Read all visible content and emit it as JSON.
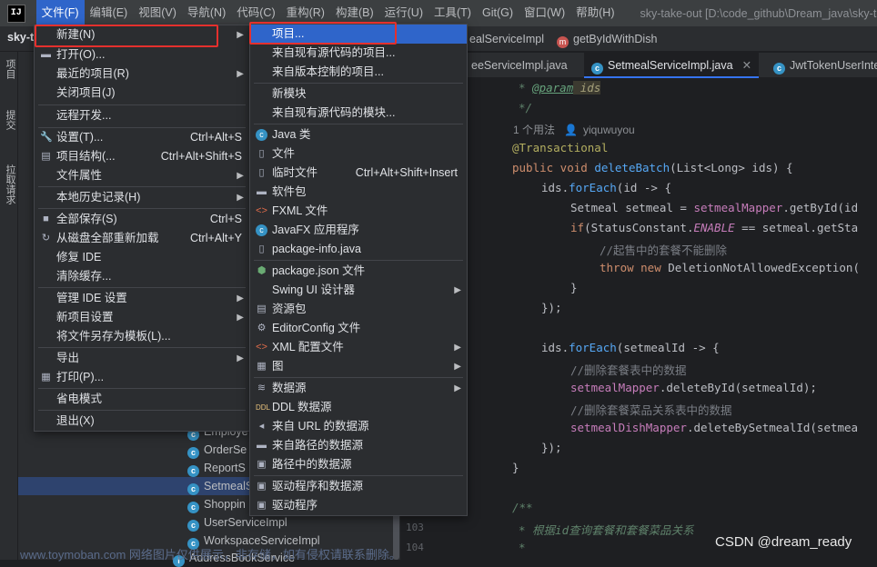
{
  "app": {
    "logo": "IJ",
    "window_title": "sky-take-out [D:\\code_github\\Dream_java\\sky-ta"
  },
  "menubar": [
    "文件(F)",
    "编辑(E)",
    "视图(V)",
    "导航(N)",
    "代码(C)",
    "重构(R)",
    "构建(B)",
    "运行(U)",
    "工具(T)",
    "Git(G)",
    "窗口(W)",
    "帮助(H)"
  ],
  "breadcrumb": {
    "project": "sky-t",
    "class": "ealServiceImpl",
    "method": "getByIdWithDish"
  },
  "tabs": [
    "eeServiceImpl.java",
    "SetmealServiceImpl.java",
    "JwtTokenUserInter"
  ],
  "left_tool": [
    "项目",
    "提交",
    "拉取请求"
  ],
  "project_tree": [
    "Employe",
    "OrderSe",
    "ReportS",
    "SetmealS",
    "Shoppin",
    "UserServiceImpl",
    "WorkspaceServiceImpl",
    "AddressBookService"
  ],
  "gutter": [
    "103",
    "104"
  ],
  "code": {
    "l1": [
      "* ",
      "@param",
      " ids"
    ],
    "l2": "*/",
    "hint_usage": "1 个用法",
    "hint_author": "yiquwuyou",
    "l3": "@Transactional",
    "l4": [
      "public void ",
      "deleteBatch",
      "(List<Long> ids) {"
    ],
    "l5": [
      "ids.",
      "forEach",
      "(id -> {"
    ],
    "l6": [
      "Setmeal setmeal = ",
      "setmealMapper",
      ".getById(id"
    ],
    "l7": [
      "if",
      "(StatusConstant.",
      "ENABLE",
      " == setmeal.getSta"
    ],
    "l8": "//起售中的套餐不能删除",
    "l9": [
      "throw new ",
      "DeletionNotAllowedException("
    ],
    "l10": "}",
    "l11": "});",
    "l12": [
      "ids.",
      "forEach",
      "(setmealId -> {"
    ],
    "l13": "//删除套餐表中的数据",
    "l14": [
      "setmealMapper",
      ".deleteById(setmealId);"
    ],
    "l15": "//删除套餐菜品关系表中的数据",
    "l16": [
      "setmealDishMapper",
      ".deleteBySetmealId(setmea"
    ],
    "l17": "});",
    "l18": "}",
    "l19": "/**",
    "l20": "* 根据id查询套餐和套餐菜品关系",
    "l21": "*"
  },
  "file_menu": {
    "new": "新建(N)",
    "open": "打开(O)...",
    "recent": "最近的项目(R)",
    "close": "关闭项目(J)",
    "remote": "远程开发...",
    "settings": "设置(T)...",
    "settings_sc": "Ctrl+Alt+S",
    "structure": "项目结构(...",
    "structure_sc": "Ctrl+Alt+Shift+S",
    "props": "文件属性",
    "local_hist": "本地历史记录(H)",
    "save_all": "全部保存(S)",
    "save_all_sc": "Ctrl+S",
    "reload": "从磁盘全部重新加载",
    "reload_sc": "Ctrl+Alt+Y",
    "repair": "修复 IDE",
    "invalidate": "清除缓存...",
    "manage_ide": "管理 IDE 设置",
    "new_proj_settings": "新项目设置",
    "save_template": "将文件另存为模板(L)...",
    "export": "导出",
    "print": "打印(P)...",
    "power_save": "省电模式",
    "exit": "退出(X)"
  },
  "new_menu": {
    "project": "项目...",
    "from_existing": "来自现有源代码的项目...",
    "from_vcs": "来自版本控制的项目...",
    "module": "新模块",
    "module_existing": "来自现有源代码的模块...",
    "java_class": "Java 类",
    "file": "文件",
    "scratch": "临时文件",
    "scratch_sc": "Ctrl+Alt+Shift+Insert",
    "package": "软件包",
    "fxml": "FXML 文件",
    "javafx": "JavaFX 应用程序",
    "pkginfo": "package-info.java",
    "pkgjson": "package.json 文件",
    "swing": "Swing UI 设计器",
    "resource": "资源包",
    "editorconfig": "EditorConfig 文件",
    "xml": "XML 配置文件",
    "diagram": "图",
    "datasource": "数据源",
    "ddl": "DDL 数据源",
    "url_ds": "来自 URL 的数据源",
    "path_ds": "来自路径的数据源",
    "in_path_ds": "路径中的数据源",
    "driver_ds": "驱动程序和数据源",
    "driver": "驱动程序"
  },
  "watermark": "CSDN @dream_ready",
  "watermark2": "www.toymoban.com 网络图片仅供展示，非存储，如有侵权请联系删除。",
  "colors": {
    "highlight": "#2f65ca",
    "annotation_box": "#e5302d"
  }
}
